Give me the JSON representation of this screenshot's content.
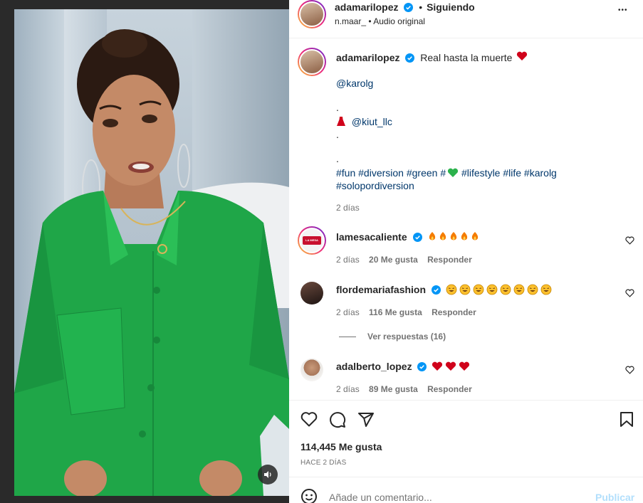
{
  "post": {
    "author": "adamarilopez",
    "follow_status": "Siguiendo",
    "separator": "•",
    "audio_user": "n.maar_",
    "audio_label": "Audio original",
    "more_label": "•••"
  },
  "caption": {
    "author": "adamarilopez",
    "text": "Real hasta la muerte",
    "mention": "@karolg",
    "dot1": ".",
    "dress_mention": "@kiut_llc",
    "dot2": ".",
    "dot3": ".",
    "hashtags_line1_a": "#fun #diversion #green #",
    "hashtags_line1_b": "#lifestyle #life #karolg",
    "hashtags_line2": "#solopordiversion",
    "time": "2 días"
  },
  "comments": [
    {
      "user": "lamesacaliente",
      "time": "2 días",
      "likes": "20 Me gusta",
      "reply": "Responder",
      "avatar_text": "LA MESA CALIENTE"
    },
    {
      "user": "flordemariafashion",
      "time": "2 días",
      "likes": "116 Me gusta",
      "reply": "Responder"
    },
    {
      "user": "adalberto_lopez",
      "time": "2 días",
      "likes": "89 Me gusta",
      "reply": "Responder"
    }
  ],
  "view_replies": "Ver respuestas (16)",
  "likes_count": "114,445 Me gusta",
  "post_time": "HACE 2 DÍAS",
  "comment_input": {
    "placeholder": "Añade un comentario...",
    "publish_label": "Publicar"
  },
  "colors": {
    "accent_blue": "#0095f6",
    "publish_disabled": "#b2dffc",
    "verified": "#0095f6",
    "red_heart": "#ed4956",
    "green_shirt": "#1fa648"
  }
}
